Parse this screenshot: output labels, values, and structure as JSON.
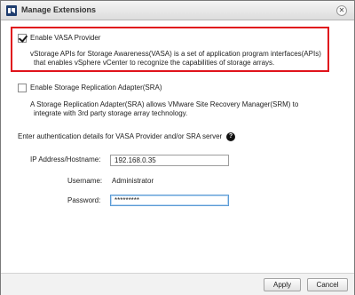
{
  "dialog": {
    "title": "Manage Extensions",
    "app_icon": "netapp-logo-icon",
    "close_icon": "close-icon"
  },
  "vasa": {
    "checked": true,
    "label": "Enable VASA Provider",
    "description_line1": "vStorage APIs for Storage Awareness(VASA) is a set of application program interfaces(APIs)",
    "description_line2": "that enables vSphere vCenter to recognize the capabilities of storage arrays.",
    "highlight_color": "#e0141c"
  },
  "sra": {
    "checked": false,
    "label": "Enable Storage Replication Adapter(SRA)",
    "description_line1": "A Storage Replication Adapter(SRA) allows VMware Site Recovery Manager(SRM) to",
    "description_line2": "integrate with 3rd party storage array technology."
  },
  "auth": {
    "prompt": "Enter authentication details for VASA Provider and/or SRA server",
    "help_icon": "help-icon",
    "ip_label": "IP Address/Hostname:",
    "ip_value": "192.168.0.35",
    "username_label": "Username:",
    "username_value": "Administrator",
    "password_label": "Password:",
    "password_value": "*********"
  },
  "footer": {
    "apply_label": "Apply",
    "cancel_label": "Cancel"
  }
}
